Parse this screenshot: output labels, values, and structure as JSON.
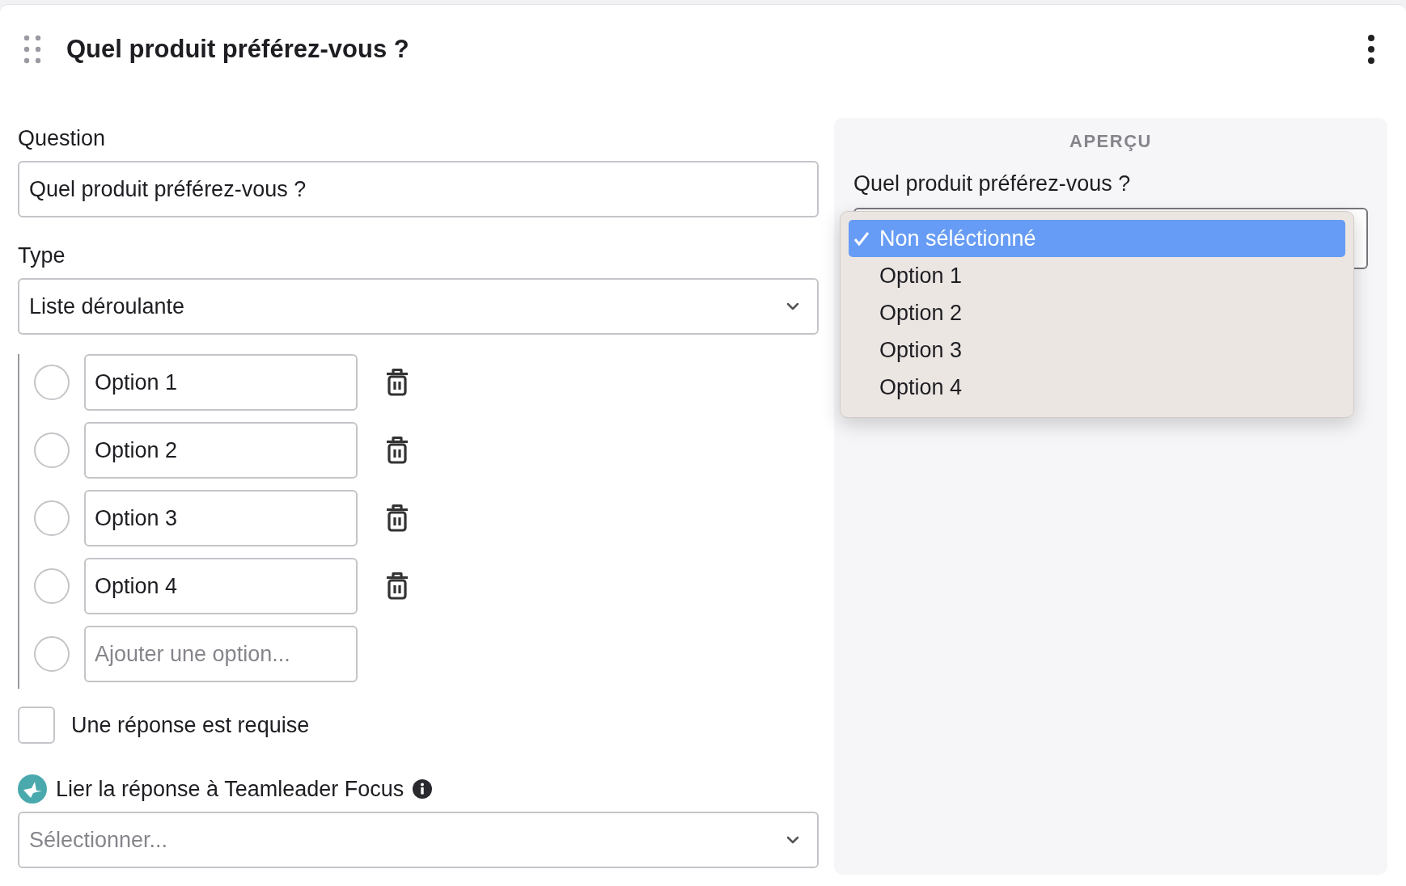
{
  "card": {
    "title": "Quel produit préférez-vous ?"
  },
  "editor": {
    "question_label": "Question",
    "question_value": "Quel produit préférez-vous ?",
    "type_label": "Type",
    "type_value": "Liste déroulante",
    "options": [
      {
        "value": "Option 1",
        "selected": false
      },
      {
        "value": "Option 2",
        "selected": false
      },
      {
        "value": "Option 3",
        "selected": false
      },
      {
        "value": "Option 4",
        "selected": false
      }
    ],
    "new_option": {
      "placeholder": "Ajouter une option...",
      "selected": false
    },
    "required": {
      "label": "Une réponse est requise",
      "checked": false
    },
    "link": {
      "label": "Lier la réponse à Teamleader Focus",
      "placeholder": "Sélectionner..."
    }
  },
  "preview": {
    "heading": "APERÇU",
    "question": "Quel produit préférez-vous ?",
    "dropdown": {
      "items": [
        {
          "label": "Non séléctionné",
          "selected": true
        },
        {
          "label": "Option 1",
          "selected": false
        },
        {
          "label": "Option 2",
          "selected": false
        },
        {
          "label": "Option 3",
          "selected": false
        },
        {
          "label": "Option 4",
          "selected": false
        }
      ]
    }
  }
}
